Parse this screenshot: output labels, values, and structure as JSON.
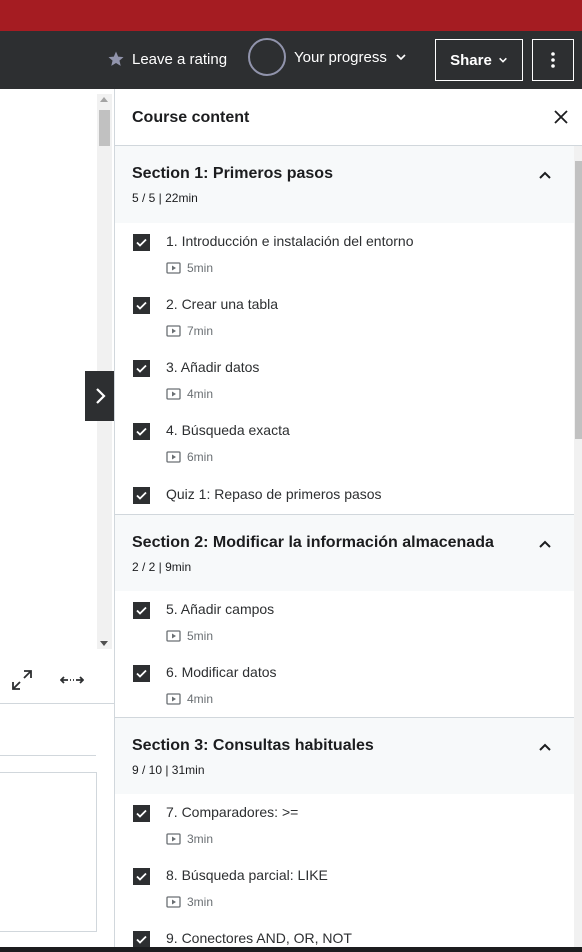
{
  "header": {
    "rating_label": "Leave a rating",
    "progress_label": "Your progress",
    "share_label": "Share"
  },
  "panel": {
    "title": "Course content"
  },
  "sections": [
    {
      "title": "Section 1: Primeros pasos",
      "meta": "5 / 5 | 22min",
      "items": [
        {
          "title": "1. Introducción e instalación del entorno",
          "duration": "5min"
        },
        {
          "title": "2. Crear una tabla",
          "duration": "7min"
        },
        {
          "title": "3. Añadir datos",
          "duration": "4min"
        },
        {
          "title": "4. Búsqueda exacta",
          "duration": "6min"
        },
        {
          "title": "Quiz 1: Repaso de primeros pasos"
        }
      ]
    },
    {
      "title": "Section 2: Modificar la información almacenada",
      "meta": "2 / 2 | 9min",
      "items": [
        {
          "title": "5. Añadir campos",
          "duration": "5min"
        },
        {
          "title": "6. Modificar datos",
          "duration": "4min"
        }
      ]
    },
    {
      "title": "Section 3: Consultas habituales",
      "meta": "9 / 10 | 31min",
      "items": [
        {
          "title": "7. Comparadores: >=",
          "duration": "3min"
        },
        {
          "title": "8. Búsqueda parcial: LIKE",
          "duration": "3min"
        },
        {
          "title": "9. Conectores AND, OR, NOT"
        }
      ]
    }
  ],
  "colors": {
    "brand_red": "#a51c22",
    "header_bg": "#2d2f31",
    "section_bg": "#f7f9fa"
  }
}
